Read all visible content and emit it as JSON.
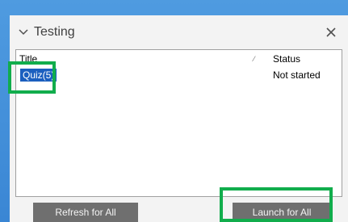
{
  "panel": {
    "title": "Testing",
    "close_symbol": "×",
    "icons": {
      "collapse": "chevron-down-icon",
      "close": "close-icon"
    }
  },
  "table": {
    "columns": [
      "Title",
      "Status"
    ],
    "rows": [
      {
        "title": "Quiz(5)",
        "status": "Not started"
      }
    ]
  },
  "buttons": {
    "refresh": "Refresh for All",
    "launch": "Launch for All"
  },
  "colors": {
    "background": "#3a86d4",
    "panel": "#f3f3f3",
    "selection": "#1b5fbf",
    "button": "#6f6f6f",
    "highlight": "#11ad4c"
  }
}
